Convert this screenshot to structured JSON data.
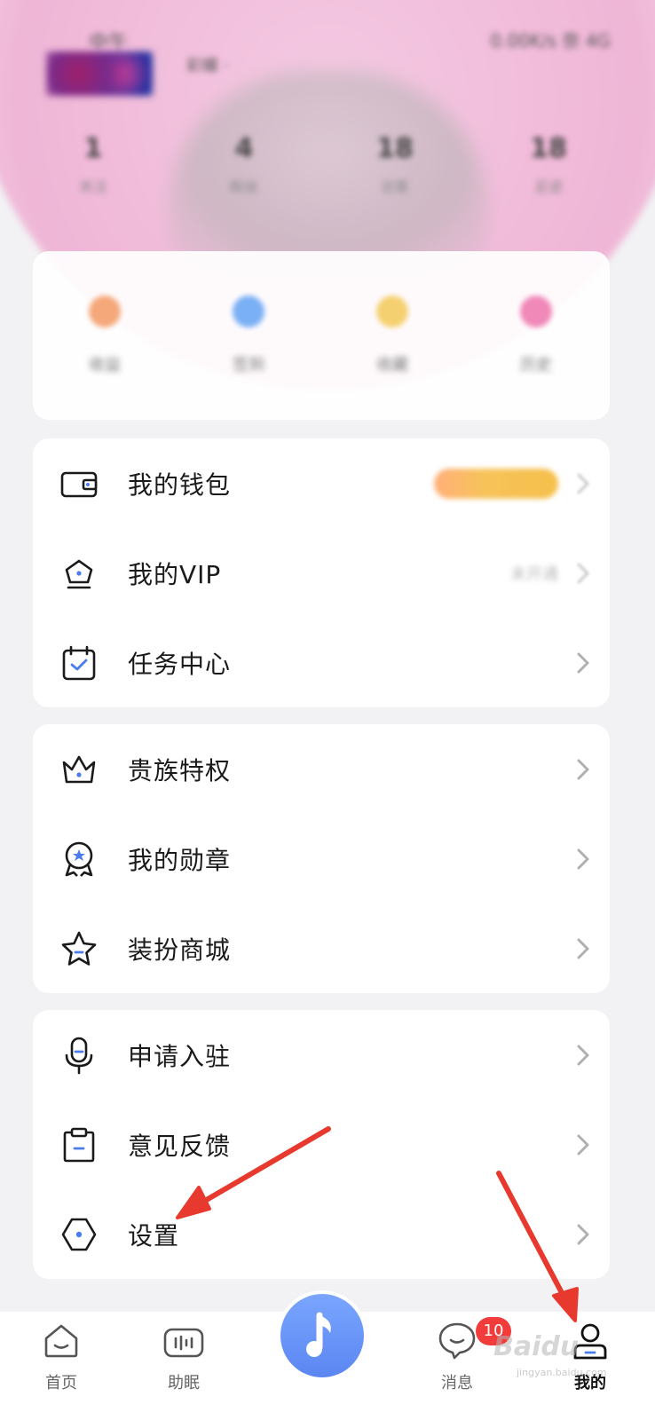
{
  "header": {
    "status_time": "中午",
    "status_right": "0.00K/s 奈 4G",
    "username": "彩蝶 ·",
    "stats": [
      {
        "value": "1",
        "label": "关注"
      },
      {
        "value": "4",
        "label": "粉丝"
      },
      {
        "value": "18",
        "label": "访客"
      },
      {
        "value": "18",
        "label": "足迹"
      }
    ]
  },
  "quick_actions": [
    {
      "label": "收益",
      "color": "#f5a87a"
    },
    {
      "label": "签到",
      "color": "#7ab0f5"
    },
    {
      "label": "收藏",
      "color": "#f5d070"
    },
    {
      "label": "历史",
      "color": "#f088b8"
    }
  ],
  "cards": [
    {
      "rows": [
        {
          "label": "我的钱包",
          "icon": "wallet-icon",
          "extra": "blur-pill"
        },
        {
          "label": "我的VIP",
          "icon": "vip-crown-icon",
          "extra": "blur-text",
          "extra_text": "未开通"
        },
        {
          "label": "任务中心",
          "icon": "calendar-check-icon",
          "extra": ""
        }
      ]
    },
    {
      "rows": [
        {
          "label": "贵族特权",
          "icon": "noble-crown-icon",
          "extra": ""
        },
        {
          "label": "我的勋章",
          "icon": "medal-icon",
          "extra": ""
        },
        {
          "label": "装扮商城",
          "icon": "star-icon",
          "extra": ""
        }
      ]
    },
    {
      "rows": [
        {
          "label": "申请入驻",
          "icon": "microphone-icon",
          "extra": ""
        },
        {
          "label": "意见反馈",
          "icon": "clipboard-icon",
          "extra": ""
        },
        {
          "label": "设置",
          "icon": "settings-hexagon-icon",
          "extra": ""
        }
      ]
    }
  ],
  "bottom_nav": {
    "items": [
      {
        "label": "首页",
        "icon": "home-icon",
        "active": false
      },
      {
        "label": "助眠",
        "icon": "sleep-radio-icon",
        "active": false
      },
      {
        "label": "",
        "icon": "music-note-icon",
        "active": false
      },
      {
        "label": "消息",
        "icon": "message-icon",
        "active": false
      },
      {
        "label": "我的",
        "icon": "profile-icon",
        "active": true
      }
    ],
    "message_badge": "10"
  },
  "watermark": {
    "text": "Baidu",
    "sub": "jingyan.baidu.com"
  },
  "colors": {
    "accent_blue": "#5b86f2",
    "badge_red": "#f23b3b",
    "annotation_red": "#e8392f",
    "icon_blue": "#4a7cf0"
  }
}
